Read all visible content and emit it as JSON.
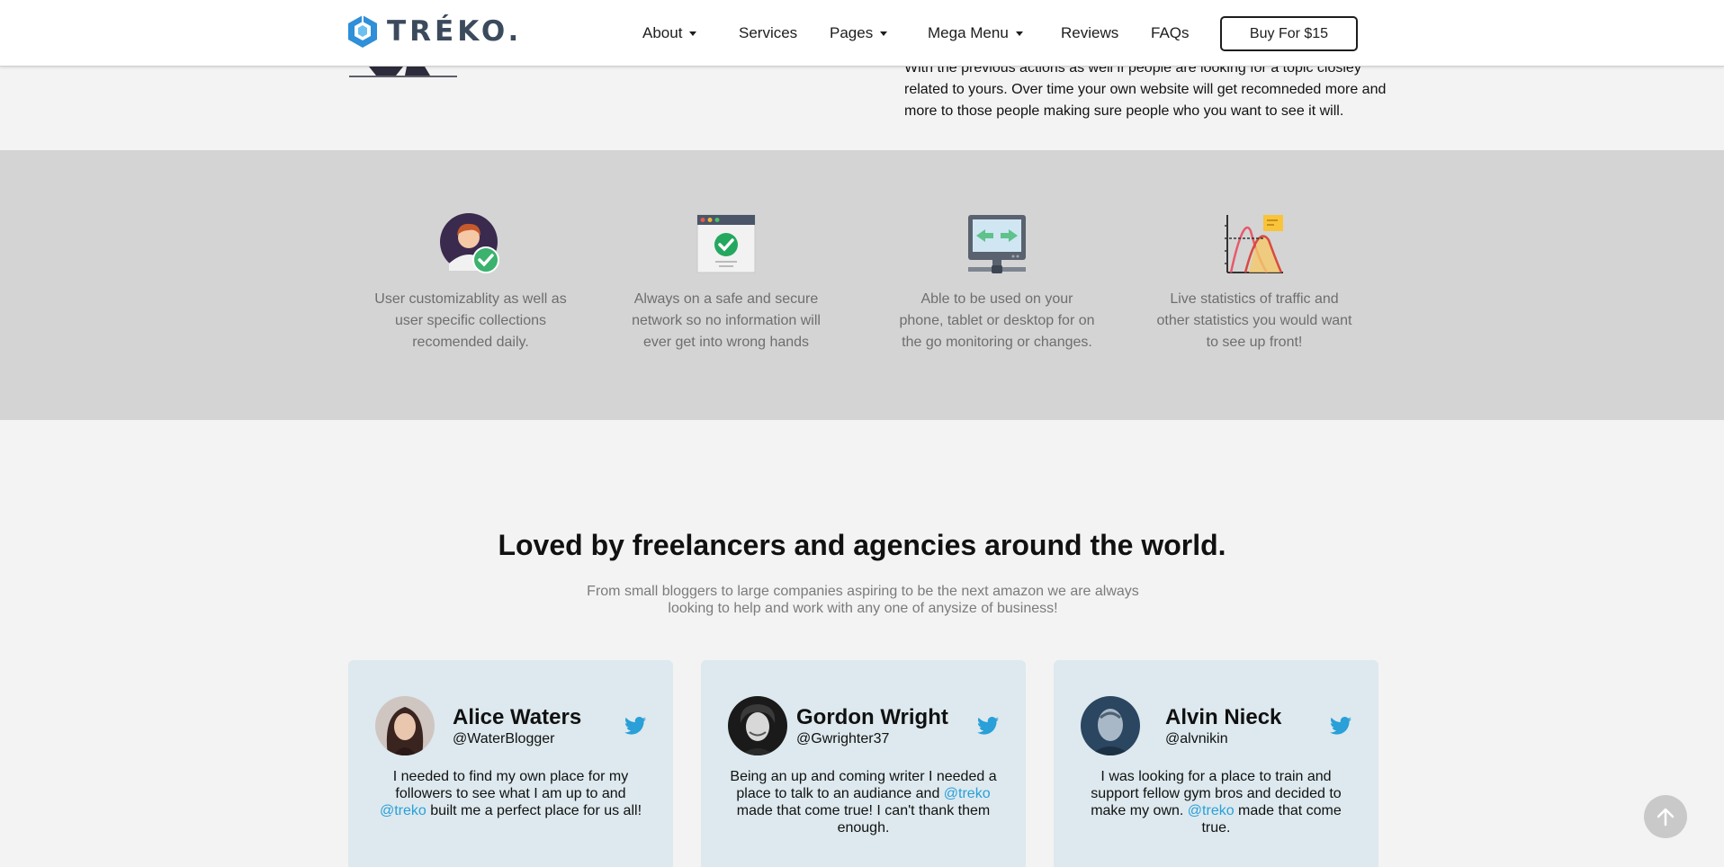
{
  "header": {
    "logo_text": "TRÉKO.",
    "nav": [
      {
        "label": "About",
        "has_caret": true
      },
      {
        "label": "Services",
        "has_caret": false
      },
      {
        "label": "Pages",
        "has_caret": true
      },
      {
        "label": "Mega Menu",
        "has_caret": true
      },
      {
        "label": "Reviews",
        "has_caret": false
      },
      {
        "label": "FAQs",
        "has_caret": false
      }
    ],
    "buy_label": "Buy For $15"
  },
  "intro": {
    "text": "With the previous actions as well if people are looking for a topic closley related to yours. Over time your own website will get recomneded more and more to those people making sure people who you want to see it will."
  },
  "features": [
    {
      "icon": "user-check-icon",
      "text": "User customizablity as well as user specific collections recomended daily."
    },
    {
      "icon": "secure-browser-icon",
      "text": "Always on a safe and secure network so no information will ever get into wrong hands"
    },
    {
      "icon": "monitor-sync-icon",
      "text": "Able to be used on your phone, tablet or desktop for on the go monitoring or changes."
    },
    {
      "icon": "statistics-chart-icon",
      "text": "Live statistics of traffic and other statistics you would want to see up front!"
    }
  ],
  "testimonials": {
    "title": "Loved by freelancers and agencies around the world.",
    "subtitle": "From small bloggers to large companies aspiring to be the next amazon we are always looking to help and work with any one of anysize of business!",
    "cards": [
      {
        "name": "Alice Waters",
        "handle": "@WaterBlogger",
        "quote_before": "I needed to find my own place for my followers to see what I am up to and ",
        "mention": "@treko",
        "quote_after": " built me a perfect place for us all!"
      },
      {
        "name": "Gordon Wright",
        "handle": "@Gwrighter37",
        "quote_before": "Being an up and coming writer I needed a place to talk to an audiance and ",
        "mention": "@treko",
        "quote_after": " made that come true! I can't thank them enough."
      },
      {
        "name": "Alvin Nieck",
        "handle": "@alvnikin",
        "quote_before": "I was looking for a place to train and support fellow gym bros and decided to make my own. ",
        "mention": "@treko",
        "quote_after": " made that come true."
      }
    ]
  },
  "colors": {
    "accent": "#2a9fd8",
    "features_bg": "#d4d4d4",
    "card_bg": "#dde9ee",
    "logo": "#3b4a5c"
  }
}
